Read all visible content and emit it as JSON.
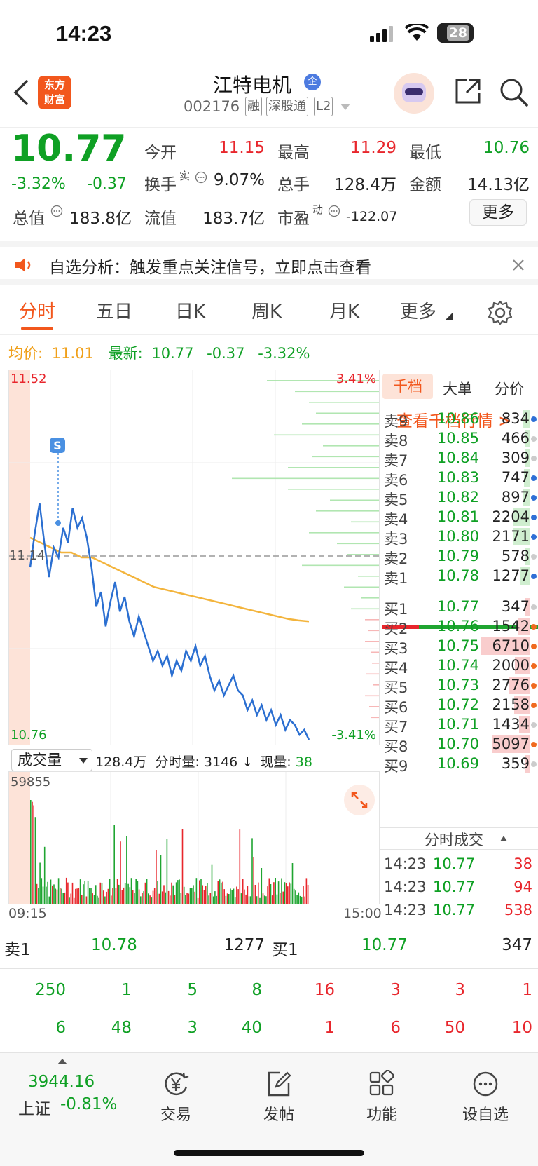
{
  "status": {
    "time": "14:23",
    "battery": "28"
  },
  "header": {
    "logo_line1": "东方",
    "logo_line2": "财富",
    "name": "江特电机",
    "name_badge": "企",
    "code": "002176",
    "tags": [
      "融",
      "深股通",
      "L2"
    ]
  },
  "quote": {
    "price": "10.77",
    "change_pct": "-3.32%",
    "change": "-0.37",
    "open_label": "今开",
    "open": "11.15",
    "high_label": "最高",
    "high": "11.29",
    "low_label": "最低",
    "low": "10.76",
    "turnover_label": "换手",
    "turnover_sup": "实",
    "turnover": "9.07%",
    "volume_label": "总手",
    "volume": "128.4万",
    "amount_label": "金额",
    "amount": "14.13亿",
    "mcap_label": "总值",
    "mcap": "183.8亿",
    "float_label": "流值",
    "float": "183.7亿",
    "pe_label": "市盈",
    "pe_sup": "动",
    "pe": "-122.07",
    "more_label": "更多"
  },
  "banner": {
    "text": "自选分析：触发重点关注信号，立即点击查看"
  },
  "tabs": {
    "items": [
      "分时",
      "五日",
      "日K",
      "周K",
      "月K",
      "更多"
    ],
    "active": "分时"
  },
  "avgline": {
    "avg_label": "均价:",
    "avg": "11.01",
    "latest_label": "最新:",
    "latest": "10.77",
    "chg": "-0.37",
    "pct": "-3.32%"
  },
  "chart_data": {
    "type": "line",
    "title": "",
    "y_top_label": "11.52",
    "y_bottom_label": "10.76",
    "y_mid_label": "11.14",
    "pct_top_label": "3.41%",
    "pct_bottom_label": "-3.41%",
    "ylim": [
      10.76,
      11.52
    ],
    "prev_close": 11.14,
    "x_start_label": "09:15",
    "x_end_label": "15:00",
    "marker": "S",
    "series": [
      {
        "values": [
          11.12,
          11.19,
          11.25,
          11.17,
          11.1,
          11.16,
          11.14,
          11.2,
          11.17,
          11.24,
          11.2,
          11.22,
          11.18,
          11.12,
          11.04,
          11.07,
          11.0,
          11.05,
          11.09,
          11.03,
          11.06,
          11.01,
          10.98,
          11.02,
          10.99,
          10.96,
          10.93,
          10.95,
          10.92,
          10.94,
          10.9,
          10.93,
          10.91,
          10.95,
          10.93,
          10.96,
          10.92,
          10.94,
          10.9,
          10.87,
          10.89,
          10.86,
          10.88,
          10.9,
          10.87,
          10.86,
          10.83,
          10.85,
          10.82,
          10.84,
          10.81,
          10.83,
          10.8,
          10.82,
          10.79,
          10.81,
          10.8,
          10.78,
          10.79,
          10.77
        ]
      },
      {
        "values": [
          11.18,
          11.17,
          11.16,
          11.15,
          11.15,
          11.14,
          11.14,
          11.13,
          11.12,
          11.11,
          11.1,
          11.09,
          11.08,
          11.075,
          11.07,
          11.065,
          11.06,
          11.055,
          11.05,
          11.045,
          11.04,
          11.035,
          11.03,
          11.025,
          11.02,
          11.015,
          11.012,
          11.01
        ]
      }
    ],
    "volume_label": "成交量",
    "volume_total": "128.4万",
    "volume_minute_label": "分时量:",
    "volume_minute": "3146",
    "volume_now_label": "现量:",
    "volume_now": "38",
    "volume_max_label": "59855"
  },
  "orderbook": {
    "tabs": [
      "千档",
      "大单",
      "分价"
    ],
    "link": "查看千档行情 >",
    "asks": [
      {
        "k": "卖9",
        "p": "10.86",
        "q": "834",
        "dot": "#2f6fd6"
      },
      {
        "k": "卖8",
        "p": "10.85",
        "q": "466",
        "dot": "#ccc"
      },
      {
        "k": "卖7",
        "p": "10.84",
        "q": "309",
        "dot": "#ccc"
      },
      {
        "k": "卖6",
        "p": "10.83",
        "q": "747",
        "dot": "#2f6fd6"
      },
      {
        "k": "卖5",
        "p": "10.82",
        "q": "897",
        "dot": "#2f6fd6"
      },
      {
        "k": "卖4",
        "p": "10.81",
        "q": "2204",
        "dot": "#2f6fd6"
      },
      {
        "k": "卖3",
        "p": "10.80",
        "q": "2171",
        "dot": "#2f6fd6"
      },
      {
        "k": "卖2",
        "p": "10.79",
        "q": "578",
        "dot": "#ccc"
      },
      {
        "k": "卖1",
        "p": "10.78",
        "q": "1277",
        "dot": "#2f6fd6"
      }
    ],
    "bids": [
      {
        "k": "买1",
        "p": "10.77",
        "q": "347",
        "dot": "#ccc"
      },
      {
        "k": "买2",
        "p": "10.76",
        "q": "1542",
        "dot": "#f06a1f"
      },
      {
        "k": "买3",
        "p": "10.75",
        "q": "6710",
        "dot": "#f06a1f"
      },
      {
        "k": "买4",
        "p": "10.74",
        "q": "2000",
        "dot": "#f06a1f"
      },
      {
        "k": "买5",
        "p": "10.73",
        "q": "2776",
        "dot": "#f06a1f"
      },
      {
        "k": "买6",
        "p": "10.72",
        "q": "2158",
        "dot": "#f06a1f"
      },
      {
        "k": "买7",
        "p": "10.71",
        "q": "1434",
        "dot": "#ccc"
      },
      {
        "k": "买8",
        "p": "10.70",
        "q": "5097",
        "dot": "#f06a1f"
      },
      {
        "k": "买9",
        "p": "10.69",
        "q": "359",
        "dot": "#ccc"
      }
    ],
    "ticks_label": "分时成交",
    "ticks": [
      {
        "t": "14:23",
        "p": "10.77",
        "v": "38"
      },
      {
        "t": "14:23",
        "p": "10.77",
        "v": "94"
      },
      {
        "t": "14:23",
        "p": "10.77",
        "v": "538"
      }
    ]
  },
  "level": {
    "ask_label": "卖1",
    "ask_price": "10.78",
    "ask_qty": "1277",
    "bid_label": "买1",
    "bid_price": "10.77",
    "bid_qty": "347",
    "ask_orders_row1": [
      "250",
      "1",
      "5",
      "8"
    ],
    "ask_orders_row2": [
      "6",
      "48",
      "3",
      "40"
    ],
    "bid_orders_row1": [
      "16",
      "3",
      "3",
      "1"
    ],
    "bid_orders_row2": [
      "1",
      "6",
      "50",
      "10"
    ]
  },
  "bottombar": {
    "index_value": "3944.16",
    "index_name": "上证",
    "index_pct": "-0.81%",
    "items": [
      "交易",
      "发帖",
      "功能",
      "设自选"
    ]
  }
}
